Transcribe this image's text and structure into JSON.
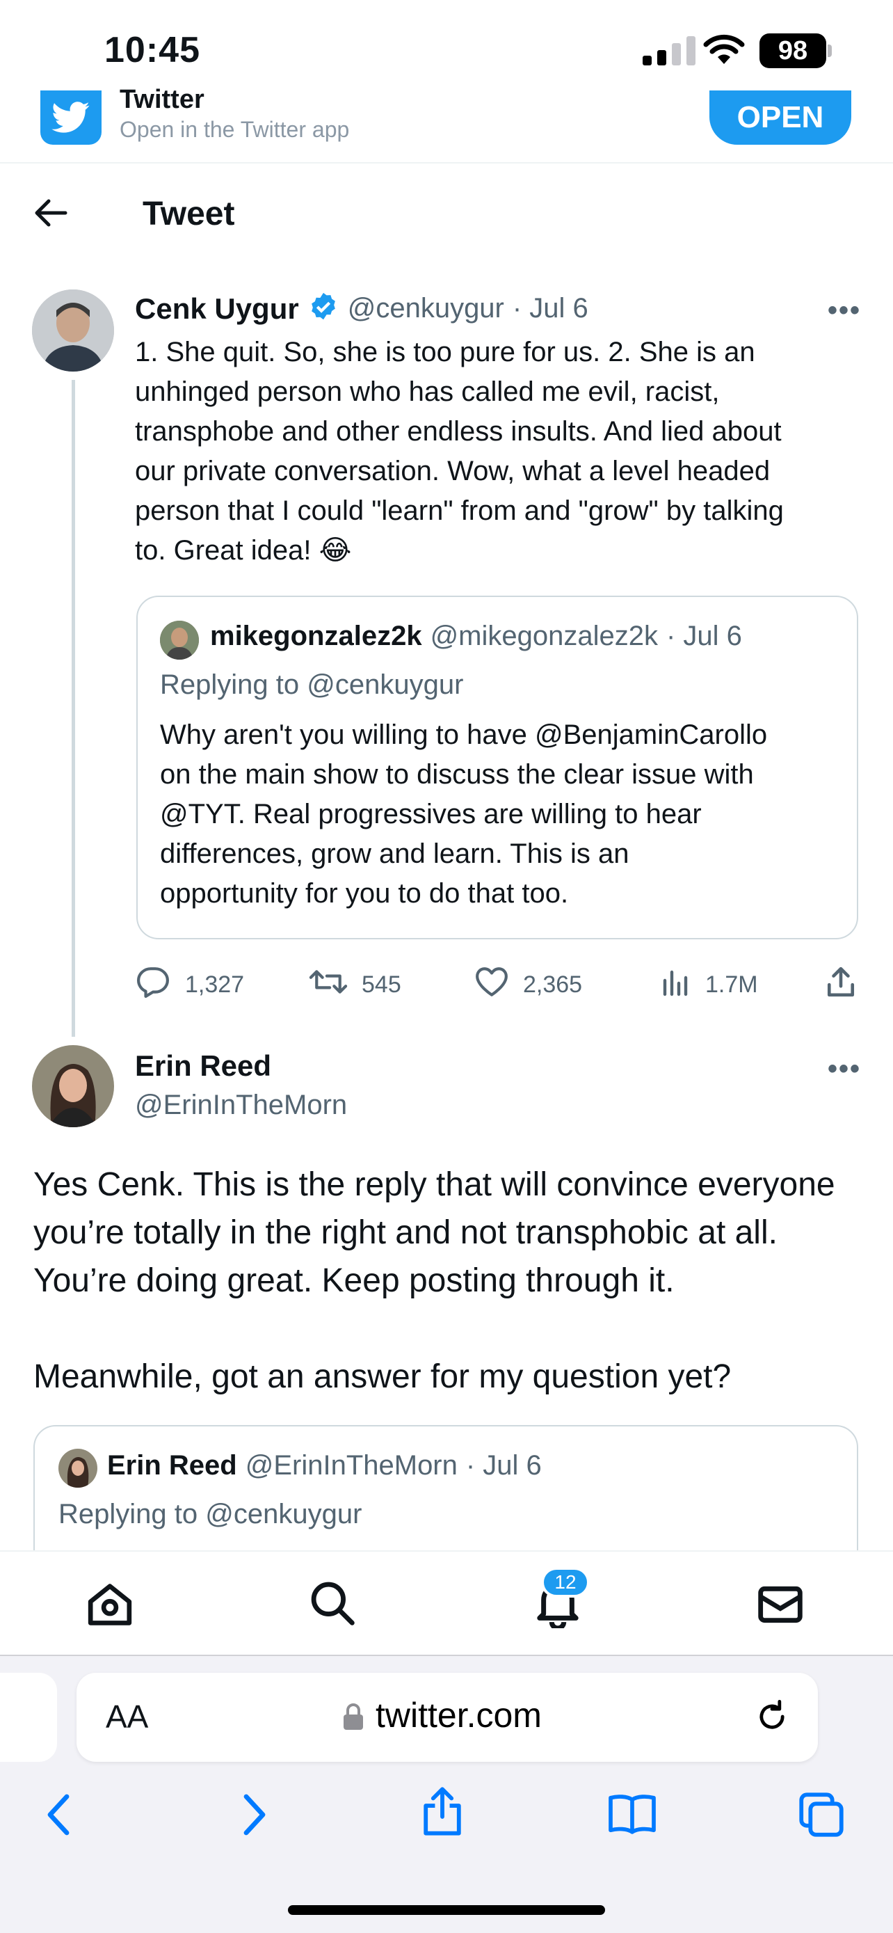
{
  "status": {
    "time": "10:45",
    "battery": "98"
  },
  "banner": {
    "title": "Twitter",
    "subtitle": "Open in the Twitter app",
    "open_label": "OPEN"
  },
  "header": {
    "title": "Tweet"
  },
  "main_tweet": {
    "author": "Cenk Uygur",
    "handle": "@cenkuygur",
    "date": "· Jul 6",
    "lines": [
      "1. She quit. So, she is too pure for us. 2. She is an",
      "unhinged person who has called me evil, racist,",
      "transphobe and other endless insults. And lied about",
      "our private conversation. Wow, what a level headed",
      "person that I could \"learn\" from and \"grow\" by talking",
      "to. Great idea! 😂"
    ],
    "quote": {
      "author": "mikegonzalez2k",
      "handle": "@mikegonzalez2k",
      "date": "· Jul 6",
      "replying": "Replying to @cenkuygur",
      "lines": [
        "Why aren't you willing to have @BenjaminCarollo",
        "on the main show to discuss the clear issue with",
        "@TYT.  Real progressives are willing to hear",
        "differences, grow and learn.  This is an",
        "opportunity for you to do that too."
      ]
    },
    "metrics": {
      "replies": "1,327",
      "retweets": "545",
      "likes": "2,365",
      "views": "1.7M"
    }
  },
  "reply_tweet": {
    "author": "Erin Reed",
    "handle": "@ErinInTheMorn",
    "lines": [
      "Yes Cenk. This is the reply that will convince everyone",
      "you’re totally in the right and not transphobic at all.",
      "You’re doing great. Keep posting through it.",
      "",
      "Meanwhile, got an answer for my question yet?"
    ],
    "quote": {
      "author": "Erin Reed",
      "handle": "@ErinInTheMorn",
      "date": "· Jul 6",
      "replying": "Replying to @cenkuygur"
    }
  },
  "tabbar": {
    "notifications_badge": "12"
  },
  "safari": {
    "aa": "AA",
    "url": "twitter.com"
  },
  "colors": {
    "accent": "#1d9bf0",
    "text": "#0f1419",
    "muted": "#536471",
    "safari_blue": "#007aff"
  }
}
